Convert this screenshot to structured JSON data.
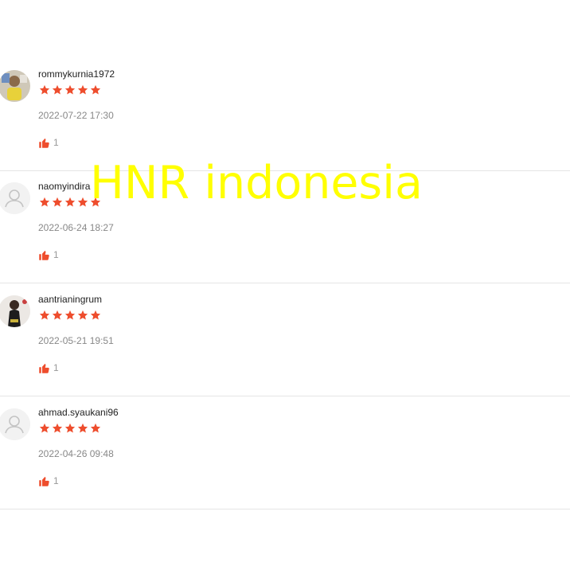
{
  "reviews": [
    {
      "username": "rommykurnia1972",
      "rating": 5,
      "timestamp": "2022-07-22 17:30",
      "likes": "1",
      "avatar": "photo"
    },
    {
      "username": "naomyindira",
      "rating": 5,
      "timestamp": "2022-06-24 18:27",
      "likes": "1",
      "avatar": "default"
    },
    {
      "username": "aantrianingrum",
      "rating": 5,
      "timestamp": "2022-05-21 19:51",
      "likes": "1",
      "avatar": "photo"
    },
    {
      "username": "ahmad.syaukani96",
      "rating": 5,
      "timestamp": "2022-04-26 09:48",
      "likes": "1",
      "avatar": "default"
    }
  ],
  "watermark": "HNR indonesia",
  "colors": {
    "star": "#ee4d2d",
    "like_icon": "#ee4d2d",
    "watermark": "#ffff00",
    "divider": "#e5e5e5"
  },
  "icons": {
    "star": "star-icon",
    "like": "thumbs-up-icon",
    "default_avatar": "user-icon"
  }
}
